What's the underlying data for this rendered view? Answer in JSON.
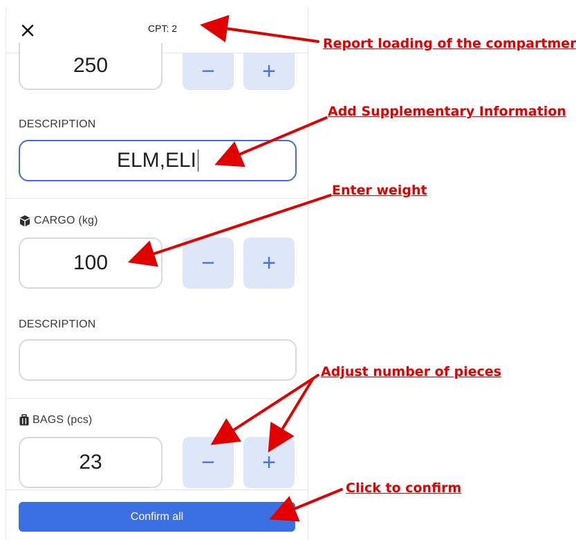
{
  "header": {
    "cpt_label": "CPT: 2"
  },
  "section_top": {
    "value": "250",
    "minus": "−",
    "plus": "+"
  },
  "description_1": {
    "label": "DESCRIPTION",
    "value": "ELM,ELI"
  },
  "cargo": {
    "label": "CARGO (kg)",
    "value": "100",
    "minus": "−",
    "plus": "+",
    "icon": "box-icon"
  },
  "description_2": {
    "label": "DESCRIPTION",
    "value": ""
  },
  "bags": {
    "label": "BAGS (pcs)",
    "value": "23",
    "minus": "−",
    "plus": "+",
    "icon": "suitcase-icon"
  },
  "footer": {
    "confirm_label": "Confirm all"
  },
  "annotations": {
    "report": "Report loading of the compartment",
    "supplementary": "Add Supplementary Information",
    "weight": "Enter weight",
    "pieces": "Adjust number of pieces",
    "confirm": "Click to confirm"
  },
  "colors": {
    "accent": "#3d6fe4",
    "stepper_bg": "#dde7f7",
    "annotation": "#e00000"
  }
}
